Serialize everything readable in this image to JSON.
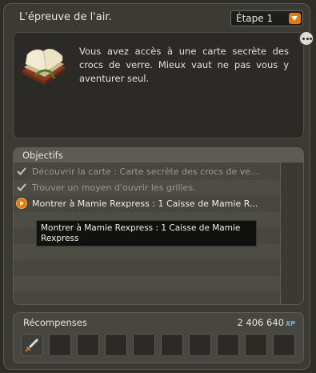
{
  "header": {
    "title": "L'épreuve de l'air.",
    "step_select": "Étape 1"
  },
  "quest": {
    "icon": "book-icon",
    "description": "Vous avez accès à une carte secrète des crocs de verre. Mieux vaut ne pas vous y aventurer seul."
  },
  "objectives": {
    "header": "Objectifs",
    "items": [
      {
        "state": "done",
        "text": "Découvrir la carte : Carte secrète des crocs de ve..."
      },
      {
        "state": "done",
        "text": "Trouver un moyen d'ouvrir les grilles."
      },
      {
        "state": "active",
        "text": "Montrer à Mamie Rexpress : 1 Caisse de Mamie R..."
      }
    ],
    "tooltip": "Montrer à Mamie Rexpress : 1 Caisse de Mamie Rexpress"
  },
  "rewards": {
    "label": "Récompenses",
    "xp_value": "2 406 640",
    "xp_unit": "XP",
    "slots": [
      {
        "icon": "sword-icon"
      },
      {
        "icon": ""
      },
      {
        "icon": ""
      },
      {
        "icon": ""
      },
      {
        "icon": ""
      },
      {
        "icon": ""
      },
      {
        "icon": ""
      },
      {
        "icon": ""
      },
      {
        "icon": ""
      },
      {
        "icon": ""
      }
    ]
  },
  "colors": {
    "accent": "#e07a12",
    "panel": "#3b3a35",
    "xp": "#7fb2e6"
  }
}
